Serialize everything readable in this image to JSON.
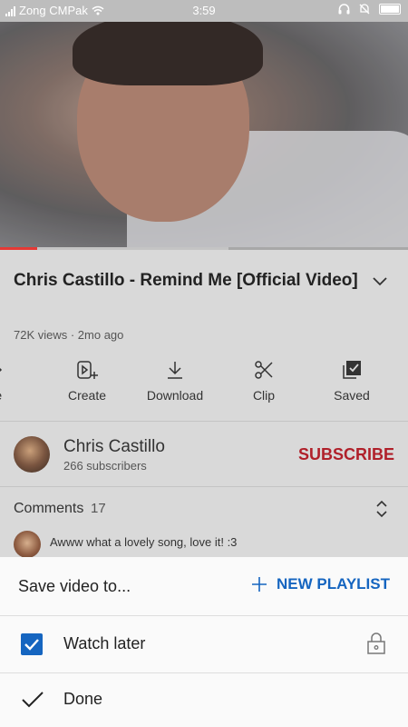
{
  "status_bar": {
    "carrier": "Zong CMPak",
    "time": "3:59"
  },
  "video": {
    "progress_fraction": 0.09,
    "buffer_fraction": 0.56
  },
  "details": {
    "title": "Chris Castillo - Remind Me [Official Video]",
    "meta": "72K views · 2mo ago"
  },
  "actions": [
    {
      "label": "are",
      "icon": "share-icon"
    },
    {
      "label": "Create",
      "icon": "create-icon"
    },
    {
      "label": "Download",
      "icon": "download-icon"
    },
    {
      "label": "Clip",
      "icon": "scissors-icon"
    },
    {
      "label": "Saved",
      "icon": "saved-icon"
    }
  ],
  "channel": {
    "name": "Chris Castillo",
    "subscribers": "266 subscribers",
    "subscribe_label": "SUBSCRIBE"
  },
  "comments": {
    "label": "Comments",
    "count": "17",
    "first_comment": "Awww what a lovely song, love it! :3"
  },
  "sheet": {
    "header": "Save video to...",
    "new_playlist_label": "NEW PLAYLIST",
    "playlists": [
      {
        "name": "Watch later",
        "checked": true,
        "privacy": "lock-icon"
      }
    ],
    "done_label": "Done"
  },
  "colors": {
    "accent_blue": "#1565c0",
    "subscribe_red": "#b0202a",
    "progress_red": "#e53935"
  }
}
